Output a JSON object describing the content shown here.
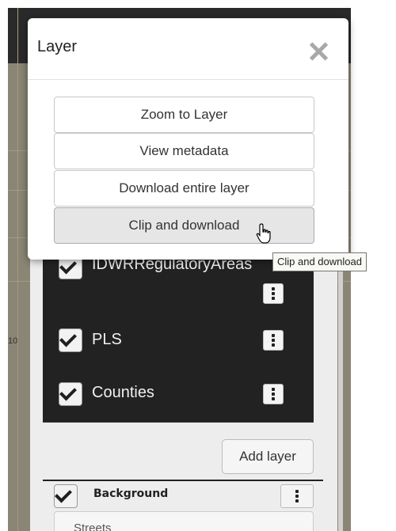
{
  "modal": {
    "title": "Layer",
    "actions": [
      {
        "label": "Zoom to Layer"
      },
      {
        "label": "View metadata"
      },
      {
        "label": "Download entire layer"
      },
      {
        "label": "Clip and download"
      }
    ]
  },
  "tooltip": "Clip and download",
  "layers": [
    {
      "name": "IDWRRegulatoryAreas",
      "checked": true
    },
    {
      "name": "PLS",
      "checked": true
    },
    {
      "name": "Counties",
      "checked": true
    }
  ],
  "add_layer_label": "Add layer",
  "background": {
    "label": "Background",
    "checked": true,
    "basemap": "Streets"
  },
  "map_label": "10",
  "icons": {
    "close": "close-icon",
    "check": "check-icon",
    "menu": "vertical-dots-icon",
    "cursor": "hand-pointer-icon"
  }
}
